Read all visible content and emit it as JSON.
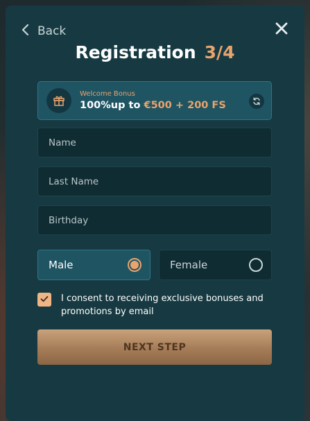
{
  "header": {
    "back_label": "Back",
    "title": "Registration",
    "step": "3/4"
  },
  "bonus": {
    "label": "Welcome Bonus",
    "amount_prefix": "100%up to ",
    "amount_highlight": "€500 + 200 FS"
  },
  "form": {
    "name_placeholder": "Name",
    "last_name_placeholder": "Last Name",
    "birthday_placeholder": "Birthday"
  },
  "gender": {
    "male_label": "Male",
    "female_label": "Female",
    "selected": "Male"
  },
  "consent": {
    "checked": true,
    "text": "I consent to receiving exclusive bonuses and promotions by email"
  },
  "next_button_label": "NEXT STEP",
  "colors": {
    "modal_bg": "#173a42",
    "accent": "#e9a46d",
    "field_bg": "#0f2c32",
    "selected_bg": "#1f5463"
  },
  "icons": {
    "back": "chevron-left-icon",
    "close": "close-icon",
    "gift": "gift-icon",
    "refresh": "refresh-icon",
    "check": "check-icon"
  }
}
